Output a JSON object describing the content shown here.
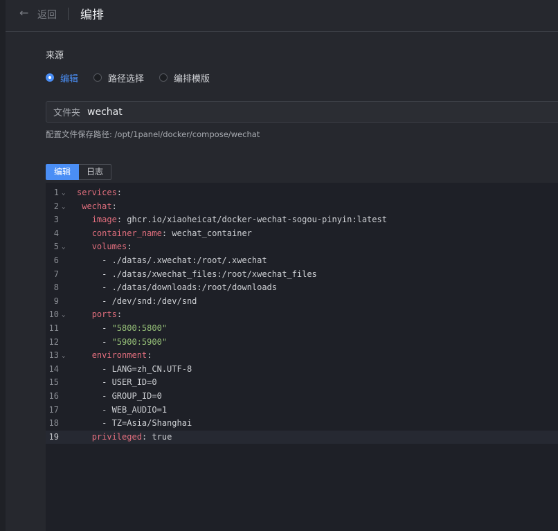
{
  "header": {
    "back_label": "返回",
    "title": "编排"
  },
  "source": {
    "label": "来源",
    "options": [
      {
        "label": "编辑",
        "selected": true
      },
      {
        "label": "路径选择",
        "selected": false
      },
      {
        "label": "编排模版",
        "selected": false
      }
    ]
  },
  "folder": {
    "prefix": "文件夹",
    "value": "wechat"
  },
  "path_hint": "配置文件保存路径: /opt/1panel/docker/compose/wechat",
  "tabs": [
    {
      "label": "编辑",
      "active": true
    },
    {
      "label": "日志",
      "active": false
    }
  ],
  "colors": {
    "accent": "#4a8ef5",
    "key": "#e36f7e",
    "string": "#98c379",
    "background": "#26282e",
    "editor_bg": "#1e2027"
  },
  "editor": {
    "current_line": 19,
    "lines": [
      {
        "n": "1",
        "fold": true,
        "key": "services",
        "sep": ":",
        "val": "",
        "val_type": "plain",
        "indent": ""
      },
      {
        "n": "2",
        "fold": true,
        "key": "wechat",
        "sep": ":",
        "val": "",
        "val_type": "plain",
        "indent": " "
      },
      {
        "n": "3",
        "fold": false,
        "key": "image",
        "sep": ": ",
        "val": "ghcr.io/xiaoheicat/docker-wechat-sogou-pinyin:latest",
        "val_type": "plain",
        "indent": "   "
      },
      {
        "n": "4",
        "fold": false,
        "key": "container_name",
        "sep": ": ",
        "val": "wechat_container",
        "val_type": "plain",
        "indent": "   "
      },
      {
        "n": "5",
        "fold": true,
        "key": "volumes",
        "sep": ":",
        "val": "",
        "val_type": "plain",
        "indent": "   "
      },
      {
        "n": "6",
        "fold": false,
        "key": "",
        "sep": "",
        "val": "- ./datas/.xwechat:/root/.xwechat",
        "val_type": "plain",
        "indent": "     "
      },
      {
        "n": "7",
        "fold": false,
        "key": "",
        "sep": "",
        "val": "- ./datas/xwechat_files:/root/xwechat_files",
        "val_type": "plain",
        "indent": "     "
      },
      {
        "n": "8",
        "fold": false,
        "key": "",
        "sep": "",
        "val": "- ./datas/downloads:/root/downloads",
        "val_type": "plain",
        "indent": "     "
      },
      {
        "n": "9",
        "fold": false,
        "key": "",
        "sep": "",
        "val": "- /dev/snd:/dev/snd",
        "val_type": "plain",
        "indent": "     "
      },
      {
        "n": "10",
        "fold": true,
        "key": "ports",
        "sep": ":",
        "val": "",
        "val_type": "plain",
        "indent": "   "
      },
      {
        "n": "11",
        "fold": false,
        "key": "",
        "sep": "- ",
        "val": "\"5800:5800\"",
        "val_type": "str",
        "indent": "     "
      },
      {
        "n": "12",
        "fold": false,
        "key": "",
        "sep": "- ",
        "val": "\"5900:5900\"",
        "val_type": "str",
        "indent": "     "
      },
      {
        "n": "13",
        "fold": true,
        "key": "environment",
        "sep": ":",
        "val": "",
        "val_type": "plain",
        "indent": "   "
      },
      {
        "n": "14",
        "fold": false,
        "key": "",
        "sep": "",
        "val": "- LANG=zh_CN.UTF-8",
        "val_type": "plain",
        "indent": "     "
      },
      {
        "n": "15",
        "fold": false,
        "key": "",
        "sep": "",
        "val": "- USER_ID=0",
        "val_type": "plain",
        "indent": "     "
      },
      {
        "n": "16",
        "fold": false,
        "key": "",
        "sep": "",
        "val": "- GROUP_ID=0",
        "val_type": "plain",
        "indent": "     "
      },
      {
        "n": "17",
        "fold": false,
        "key": "",
        "sep": "",
        "val": "- WEB_AUDIO=1",
        "val_type": "plain",
        "indent": "     "
      },
      {
        "n": "18",
        "fold": false,
        "key": "",
        "sep": "",
        "val": "- TZ=Asia/Shanghai",
        "val_type": "plain",
        "indent": "     "
      },
      {
        "n": "19",
        "fold": false,
        "key": "privileged",
        "sep": ": ",
        "val": "true",
        "val_type": "plain",
        "indent": "   "
      }
    ]
  }
}
